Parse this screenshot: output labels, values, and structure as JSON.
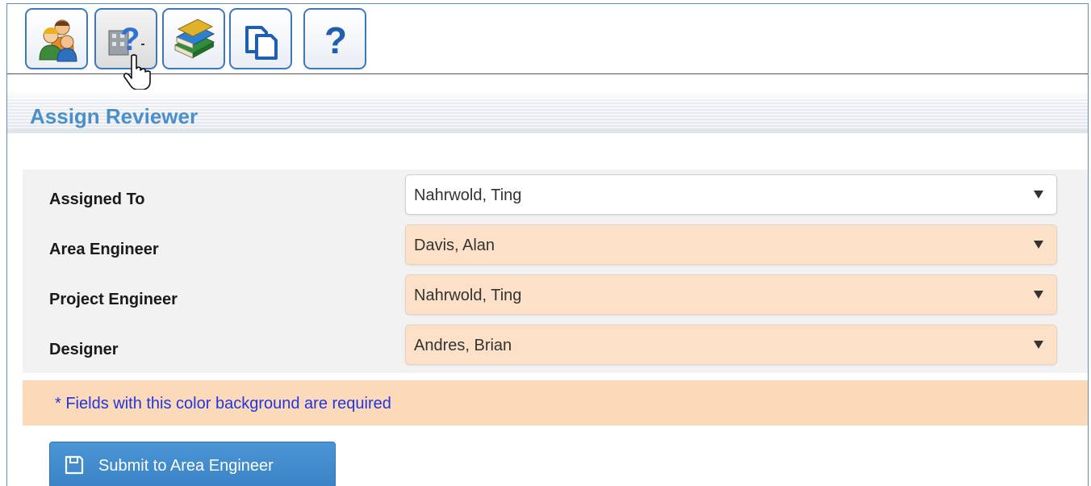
{
  "toolbar": {
    "buttons": [
      {
        "icon": "users-icon"
      },
      {
        "icon": "help-building-icon"
      },
      {
        "icon": "books-icon"
      },
      {
        "icon": "copy-pages-icon"
      },
      {
        "icon": "question-mark-icon"
      }
    ]
  },
  "section": {
    "title": "Assign Reviewer"
  },
  "form": {
    "fields": [
      {
        "label": "Assigned To",
        "value": "Nahrwold, Ting",
        "required": false
      },
      {
        "label": "Area Engineer",
        "value": "Davis, Alan",
        "required": true
      },
      {
        "label": "Project Engineer",
        "value": "Nahrwold, Ting",
        "required": true
      },
      {
        "label": "Designer",
        "value": "Andres, Brian",
        "required": true
      }
    ],
    "required_note": "* Fields with this color background are required"
  },
  "submit": {
    "label": "Submit to Area Engineer",
    "icon": "save-icon"
  },
  "colors": {
    "accent": "#4a8fcc",
    "required_bg": "#fce1c8",
    "note_text": "#1f37e0",
    "button": "#3f8bcf"
  }
}
